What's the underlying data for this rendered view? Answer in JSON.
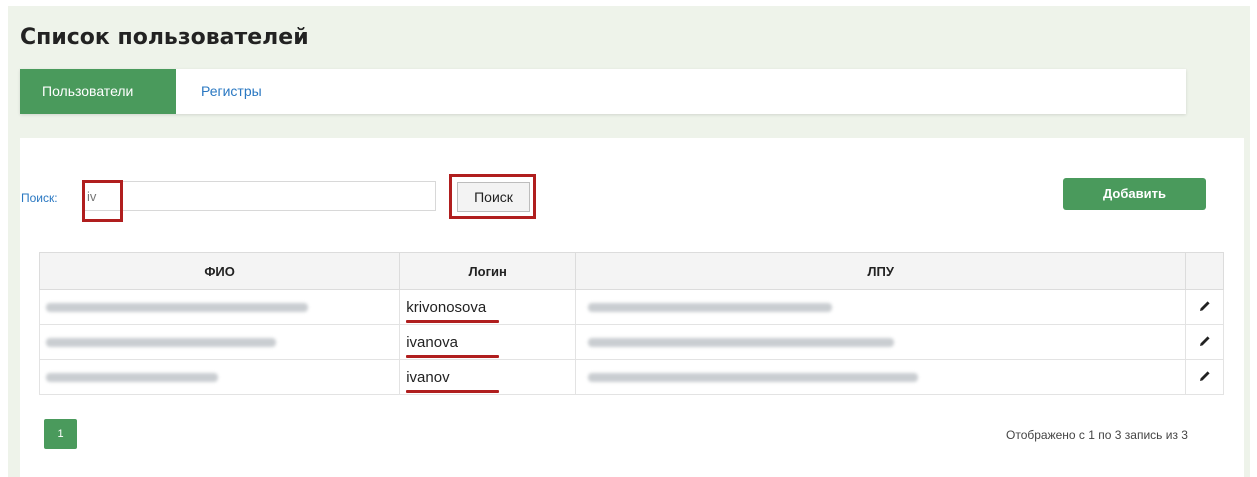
{
  "page": {
    "title": "Список пользователей"
  },
  "tabs": [
    {
      "label": "Пользователи",
      "active": true
    },
    {
      "label": "Регистры",
      "active": false
    }
  ],
  "search": {
    "label": "Поиск:",
    "value": "iv",
    "button_label": "Поиск"
  },
  "toolbar": {
    "add_label": "Добавить"
  },
  "table": {
    "columns": [
      "ФИО",
      "Логин",
      "ЛПУ",
      ""
    ],
    "rows": [
      {
        "login": "krivonosova"
      },
      {
        "login": "ivanova"
      },
      {
        "login": "ivanov"
      }
    ]
  },
  "pagination": {
    "current_page": "1",
    "info": "Отображено с 1 по 3 запись из 3"
  },
  "colors": {
    "accent_green": "#4a9a5c",
    "highlight_red": "#b01e1e",
    "link_blue": "#2a78c2"
  }
}
